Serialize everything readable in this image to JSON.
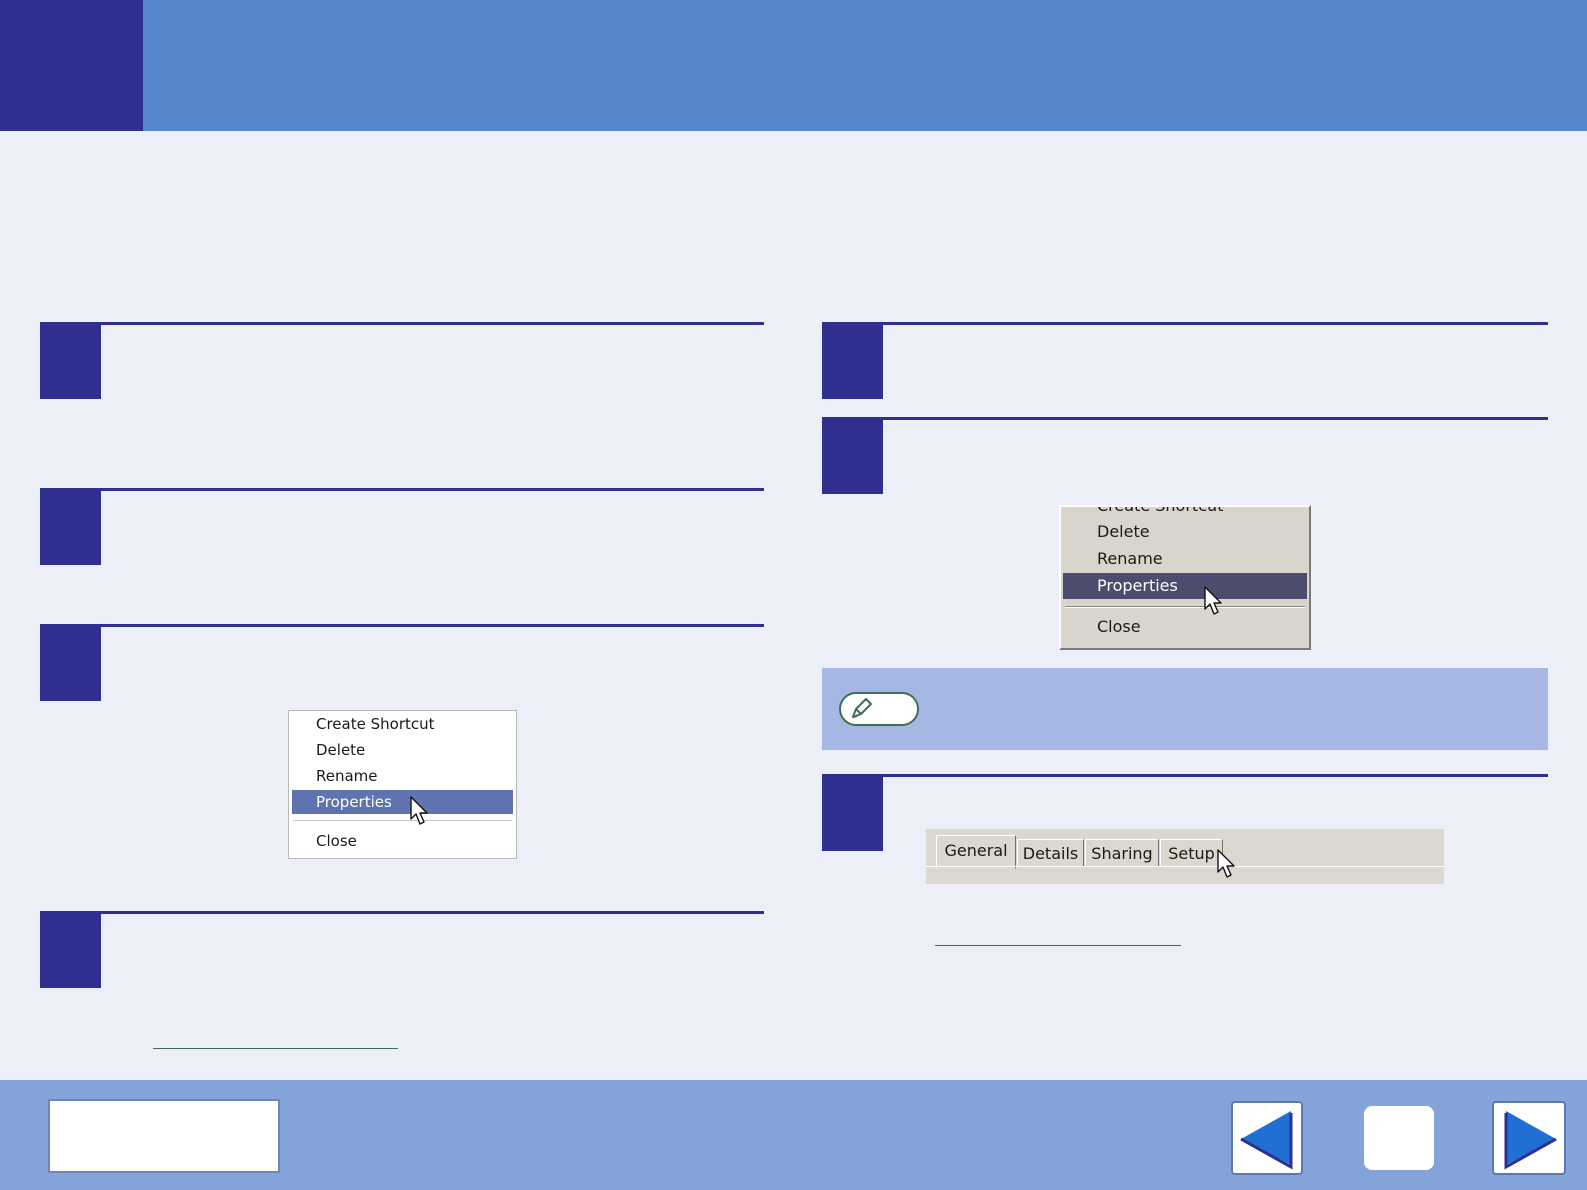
{
  "menu_left": {
    "items": [
      "Create Shortcut",
      "Delete",
      "Rename",
      "Properties",
      "Close"
    ],
    "selected": "Properties"
  },
  "menu_right": {
    "items": [
      "Create Shortcut",
      "Delete",
      "Rename",
      "Properties",
      "Close"
    ],
    "selected": "Properties"
  },
  "tabs": {
    "labels": [
      "General",
      "Details",
      "Sharing",
      "Setup"
    ],
    "active": "General"
  },
  "icons": {
    "note": "pencil-icon",
    "previous": "arrow-left-icon",
    "next": "arrow-right-icon",
    "pointer": "mouse-pointer-icon"
  },
  "colors": {
    "header": "#5687cb",
    "accent": "#2f2f8f",
    "note_bar": "#a7b7e4",
    "footer": "#84a3d8",
    "nav_arrow": "#1f6fd4"
  }
}
